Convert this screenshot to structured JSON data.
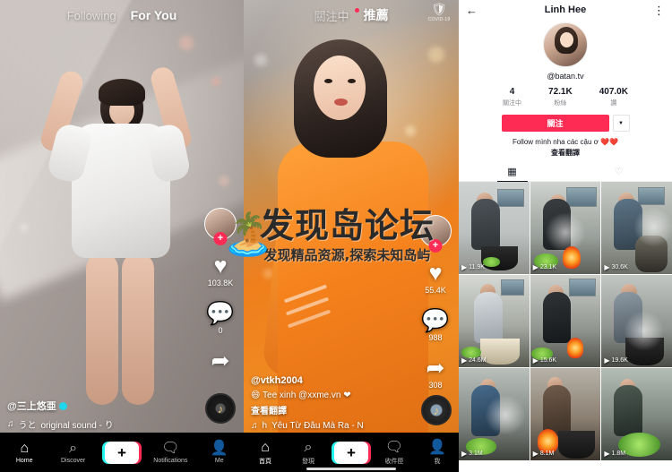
{
  "feed_en": {
    "tabs": [
      {
        "label": "Following",
        "active": false
      },
      {
        "label": "For You",
        "active": true
      }
    ],
    "rail": {
      "like_count": "103.8K",
      "comment_count": "0",
      "share_count": "",
      "heart_icon": "heart-icon",
      "comment_icon": "comment-icon",
      "share_icon": "share-icon",
      "follow_plus": "+"
    },
    "caption": {
      "username": "@三上悠亜",
      "music": "original sound - り",
      "music_prefix": "うと",
      "music_icon": "music-note-icon"
    },
    "nav": [
      {
        "icon": "home-icon",
        "label": "Home"
      },
      {
        "icon": "search-icon",
        "label": "Discover"
      },
      {
        "icon": "create-icon",
        "label": "+"
      },
      {
        "icon": "inbox-icon",
        "label": "Notifications"
      },
      {
        "icon": "profile-icon",
        "label": "Me"
      }
    ]
  },
  "feed_zh": {
    "tabs": [
      {
        "label": "關注中",
        "active": false
      },
      {
        "label": "推薦",
        "active": true
      }
    ],
    "covid": {
      "icon": "shield-icon",
      "label": "COVID-19"
    },
    "rail": {
      "like_count": "55.4K",
      "comment_count": "988",
      "share_count": "308",
      "heart_icon": "heart-icon",
      "comment_icon": "comment-icon",
      "share_icon": "share-icon",
      "follow_plus": "+"
    },
    "caption": {
      "username": "@vtkh2004",
      "description": "😄 Tee xinh @xxme.vn ❤",
      "translate": "查看翻譯",
      "music": "Yêu Từ Đâu Mà Ra - N",
      "music_prefix": "h",
      "music_icon": "music-note-icon"
    },
    "nav": [
      {
        "icon": "home-icon",
        "label": "首頁"
      },
      {
        "icon": "search-icon",
        "label": "發現"
      },
      {
        "icon": "create-icon",
        "label": "+"
      },
      {
        "icon": "inbox-icon",
        "label": "收件匣"
      },
      {
        "icon": "profile-icon",
        "label": "我"
      }
    ]
  },
  "profile": {
    "header": {
      "back_icon": "back-arrow-icon",
      "title": "Linh Hee",
      "more_icon": "more-options-icon"
    },
    "handle": "@batan.tv",
    "stats": [
      {
        "value": "4",
        "label": "關注中"
      },
      {
        "value": "72.1K",
        "label": "粉絲"
      },
      {
        "value": "407.0K",
        "label": "讚"
      }
    ],
    "follow_button": "關注",
    "dropdown_icon": "chevron-down-icon",
    "bio": "Follow mình nha các cậu ơ ❤️❤️",
    "translate": "查看翻譯",
    "tabs": [
      {
        "icon": "grid-icon",
        "active": true
      },
      {
        "icon": "liked-lock-icon",
        "active": false
      }
    ],
    "videos": [
      {
        "views": "11.9K"
      },
      {
        "views": "23.1K"
      },
      {
        "views": "30.6K"
      },
      {
        "views": "24.6M"
      },
      {
        "views": "15.6K"
      },
      {
        "views": "19.6K"
      },
      {
        "views": "3.1M"
      },
      {
        "views": "8.1M"
      },
      {
        "views": "1.8M"
      }
    ],
    "play_icon": "play-icon"
  },
  "watermark": {
    "title": "发现岛论坛",
    "subtitle": "发现精品资源,探索未知岛屿",
    "emoji": "🏝️"
  },
  "colors": {
    "accent_red": "#fe2c55",
    "accent_cyan": "#25f4ee",
    "text_dark": "#161823",
    "text_muted": "#86878b"
  }
}
